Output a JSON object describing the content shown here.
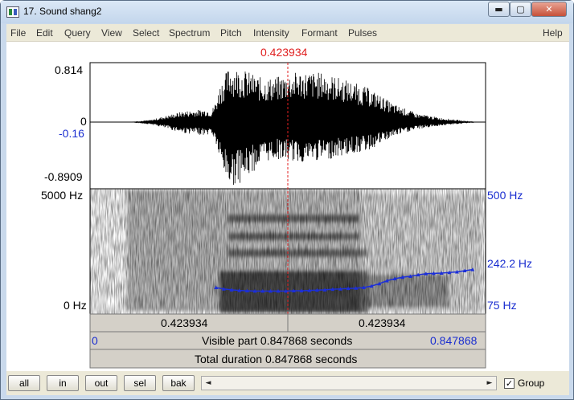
{
  "window": {
    "title": "17. Sound shang2",
    "minimize": "▬",
    "maximize": "▢",
    "close": "✕"
  },
  "menu": [
    "File",
    "Edit",
    "Query",
    "View",
    "Select",
    "Spectrum",
    "Pitch",
    "Intensity",
    "Formant",
    "Pulses"
  ],
  "help": "Help",
  "cursor": {
    "time_label": "0.423934",
    "time": 0.423934
  },
  "waveform": {
    "max_label": "0.814",
    "zero_label": "0",
    "cursor_value_label": "-0.16",
    "min_label": "-0.8909"
  },
  "spectrogram": {
    "freq_top_label": "5000 Hz",
    "freq_bottom_label": "0 Hz",
    "pitch_top_label": "500 Hz",
    "pitch_mid_label": "242.2 Hz",
    "pitch_bottom_label": "75 Hz"
  },
  "bars": {
    "left_interval": "0.423934",
    "right_interval": "0.423934",
    "visible_start": "0",
    "visible_part": "Visible part 0.847868 seconds",
    "visible_end": "0.847868",
    "total_duration": "Total duration 0.847868 seconds"
  },
  "zoom_buttons": [
    "all",
    "in",
    "out",
    "sel",
    "bak"
  ],
  "scroll": {
    "left_arrow": "◄",
    "right_arrow": "►"
  },
  "group": {
    "label": "Group",
    "checked": "✓"
  },
  "colors": {
    "cursor": "#e02020",
    "pitch": "#1c2fd8",
    "blue_label": "#1a2ed0"
  },
  "pitch_track": {
    "start_time": 0.27,
    "end_time": 0.82,
    "hz": [
      165,
      160,
      157,
      155,
      154,
      153,
      153,
      153,
      153,
      153,
      154,
      154,
      155,
      156,
      157,
      159,
      160,
      162,
      163,
      165,
      170,
      178,
      188,
      195,
      200,
      203,
      208,
      212,
      213,
      214,
      216,
      218,
      222,
      226
    ]
  },
  "waveform_envelope": {
    "times": [
      0.0,
      0.08,
      0.13,
      0.2,
      0.25,
      0.26,
      0.27,
      0.28,
      0.3,
      0.33,
      0.37,
      0.4,
      0.45,
      0.5,
      0.55,
      0.6,
      0.65,
      0.7,
      0.75,
      0.8,
      0.84
    ],
    "top": [
      0.0,
      0.0,
      0.03,
      0.15,
      0.18,
      0.15,
      0.3,
      0.55,
      0.78,
      0.72,
      0.6,
      0.62,
      0.7,
      0.68,
      0.58,
      0.46,
      0.25,
      0.12,
      0.06,
      0.02,
      0.0
    ],
    "bottom": [
      0.0,
      0.0,
      -0.03,
      -0.15,
      -0.18,
      -0.15,
      -0.3,
      -0.6,
      -0.88,
      -0.8,
      -0.55,
      -0.5,
      -0.55,
      -0.52,
      -0.45,
      -0.38,
      -0.2,
      -0.1,
      -0.05,
      -0.02,
      0.0
    ]
  }
}
